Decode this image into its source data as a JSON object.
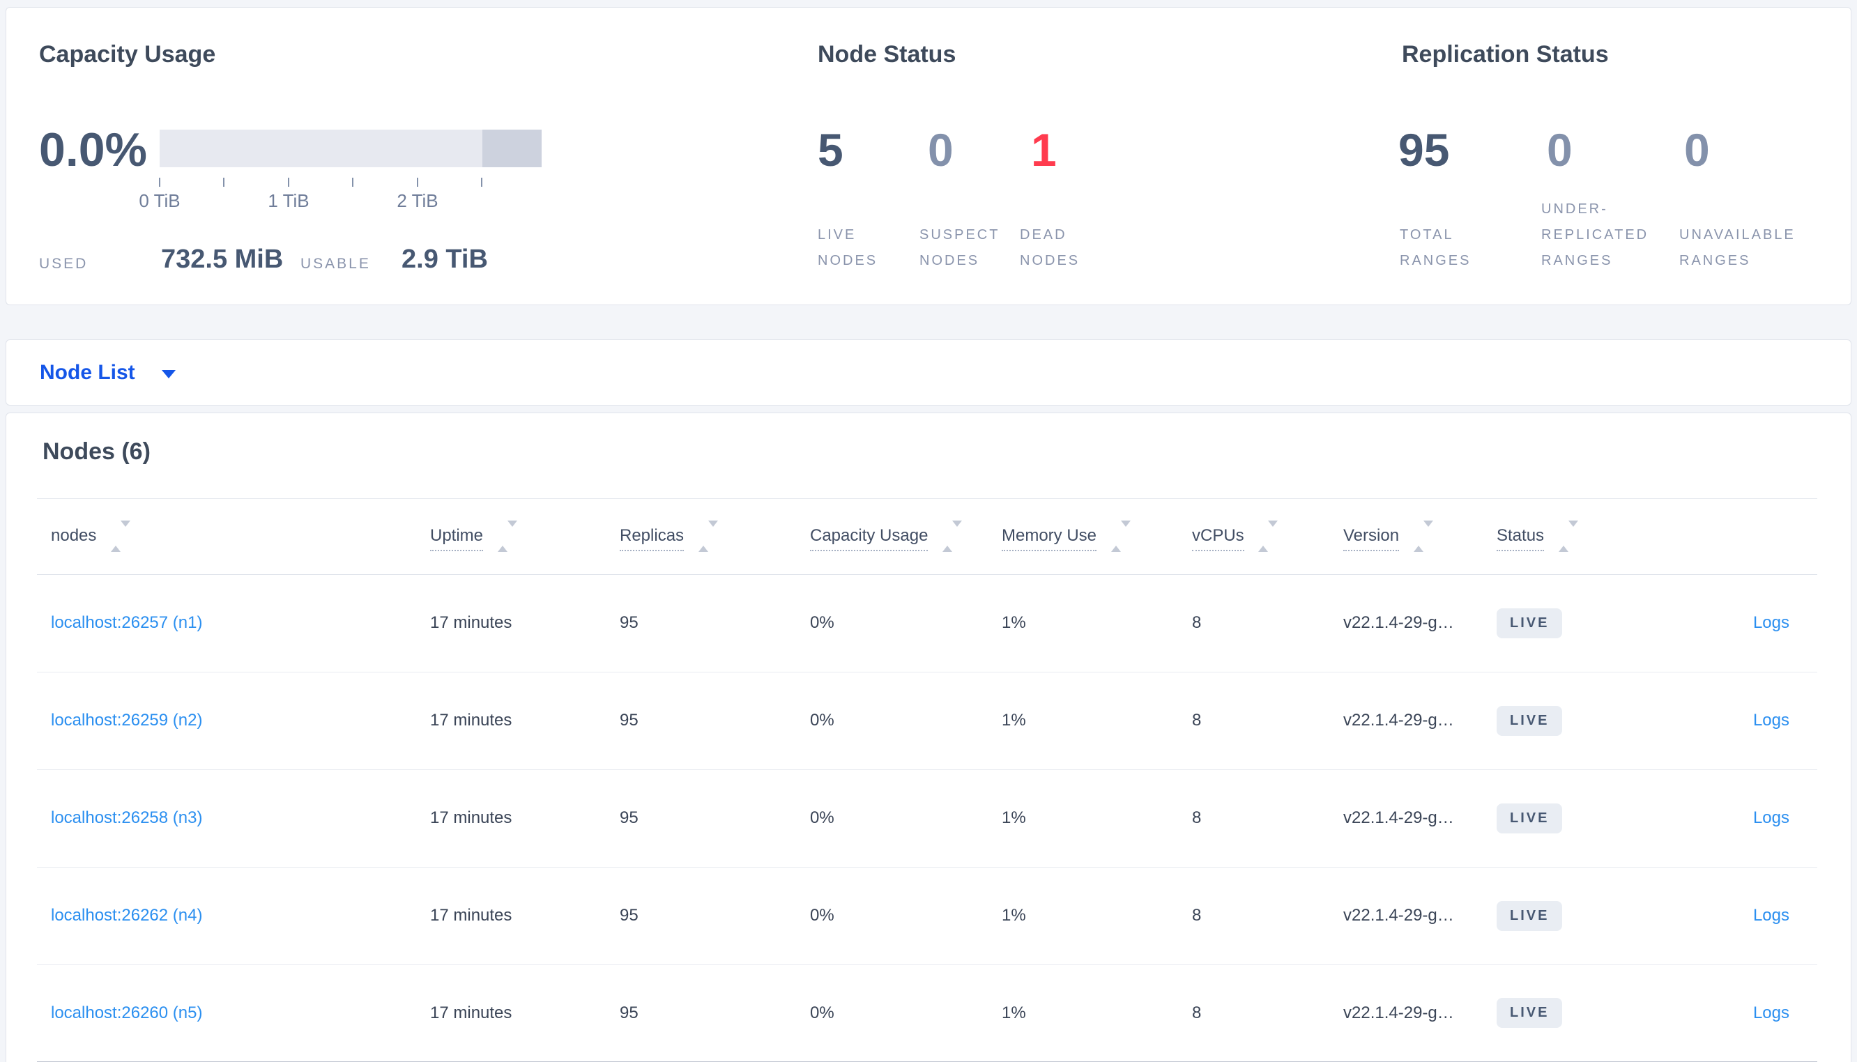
{
  "summary": {
    "capacity": {
      "title": "Capacity Usage",
      "percent": "0.0%",
      "tick_labels": [
        "0 TiB",
        "1 TiB",
        "2 TiB"
      ],
      "used_label": "USED",
      "used_value": "732.5 MiB",
      "usable_label": "USABLE",
      "usable_value": "2.9 TiB"
    },
    "node_status": {
      "title": "Node Status",
      "metrics": [
        {
          "value": "5",
          "label": "LIVE NODES"
        },
        {
          "value": "0",
          "label": "SUSPECT NODES"
        },
        {
          "value": "1",
          "label": "DEAD NODES"
        }
      ]
    },
    "replication_status": {
      "title": "Replication Status",
      "metrics": [
        {
          "value": "95",
          "label": "TOTAL RANGES"
        },
        {
          "value": "0",
          "label": "UNDER-REPLICATED RANGES"
        },
        {
          "value": "0",
          "label": "UNAVAILABLE RANGES"
        }
      ]
    }
  },
  "view_selector": {
    "label": "Node List"
  },
  "nodes_section": {
    "heading": "Nodes (6)",
    "columns": [
      {
        "label": "nodes"
      },
      {
        "label": "Uptime"
      },
      {
        "label": "Replicas"
      },
      {
        "label": "Capacity Usage"
      },
      {
        "label": "Memory Use"
      },
      {
        "label": "vCPUs"
      },
      {
        "label": "Version"
      },
      {
        "label": "Status"
      }
    ],
    "rows": [
      {
        "node": "localhost:26257 (n1)",
        "uptime": "17 minutes",
        "replicas": "95",
        "capacity": "0%",
        "memory": "1%",
        "vcpus": "8",
        "version": "v22.1.4-29-g…",
        "status": "LIVE",
        "logs": "Logs"
      },
      {
        "node": "localhost:26259 (n2)",
        "uptime": "17 minutes",
        "replicas": "95",
        "capacity": "0%",
        "memory": "1%",
        "vcpus": "8",
        "version": "v22.1.4-29-g…",
        "status": "LIVE",
        "logs": "Logs"
      },
      {
        "node": "localhost:26258 (n3)",
        "uptime": "17 minutes",
        "replicas": "95",
        "capacity": "0%",
        "memory": "1%",
        "vcpus": "8",
        "version": "v22.1.4-29-g…",
        "status": "LIVE",
        "logs": "Logs"
      },
      {
        "node": "localhost:26262 (n4)",
        "uptime": "17 minutes",
        "replicas": "95",
        "capacity": "0%",
        "memory": "1%",
        "vcpus": "8",
        "version": "v22.1.4-29-g…",
        "status": "LIVE",
        "logs": "Logs"
      },
      {
        "node": "localhost:26260 (n5)",
        "uptime": "17 minutes",
        "replicas": "95",
        "capacity": "0%",
        "memory": "1%",
        "vcpus": "8",
        "version": "v22.1.4-29-g…",
        "status": "LIVE",
        "logs": "Logs"
      }
    ]
  },
  "colors": {
    "accent_blue": "#1556e8",
    "link_blue": "#2b8ff0",
    "dead_red": "#ff3b4e",
    "dark_slate": "#475872",
    "muted_slate": "#8391ab",
    "bar_light": "#e7e9f0",
    "bar_dark": "#cdd2de",
    "page_background": "#f3f5f9"
  }
}
